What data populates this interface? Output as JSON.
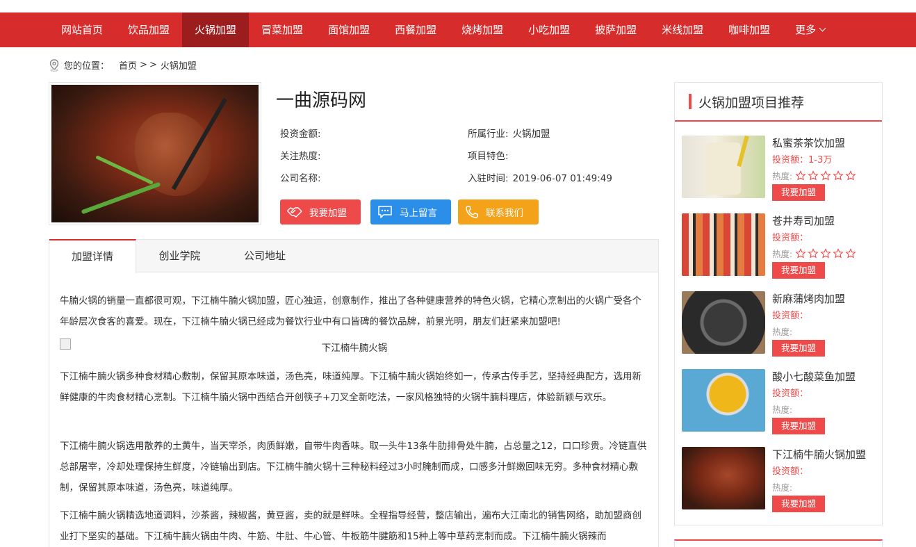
{
  "nav": {
    "items": [
      {
        "label": "网站首页"
      },
      {
        "label": "饮品加盟"
      },
      {
        "label": "火锅加盟",
        "active": true
      },
      {
        "label": "冒菜加盟"
      },
      {
        "label": "面馆加盟"
      },
      {
        "label": "西餐加盟"
      },
      {
        "label": "烧烤加盟"
      },
      {
        "label": "小吃加盟"
      },
      {
        "label": "披萨加盟"
      },
      {
        "label": "米线加盟"
      },
      {
        "label": "咖啡加盟"
      },
      {
        "label": "更多"
      }
    ]
  },
  "breadcrumb": {
    "prefix": "您的位置：",
    "home": "首页",
    "sep": ">",
    "sep2": ">",
    "current": "火锅加盟"
  },
  "project": {
    "title": "一曲源码网",
    "invest_label": "投资金额:",
    "industry_label": "所属行业:",
    "industry_value": "火锅加盟",
    "heat_label": "关注热度:",
    "feature_label": "项目特色:",
    "company_label": "公司名称:",
    "joined_label": "入驻时间:",
    "joined_value": "2019-06-07 01:49:49"
  },
  "buttons": {
    "join": "我要加盟",
    "message": "马上留言",
    "contact": "联系我们"
  },
  "tabs": [
    "加盟详情",
    "创业学院",
    "公司地址"
  ],
  "article": {
    "p1": "牛腩火锅的销量一直都很可观，下江楠牛腩火锅加盟，匠心独运，创意制作，推出了各种健康营养的特色火锅，它精心烹制出的火锅广受各个年龄层次食客的喜爱。现在，下江楠牛腩火锅已经成为餐饮行业中有口皆碑的餐饮品牌，前景光明，朋友们赶紧来加盟吧!",
    "image_caption": "下江楠牛腩火锅",
    "p2": "下江楠牛腩火锅多种食材精心敷制，保留其原本味道，汤色亮，味道纯厚。下江楠牛腩火锅始终如一，传承古传手艺，坚持经典配方，选用新鲜健康的牛肉食材精心烹制。下江楠牛腩火锅中西结合开创筷子+刀叉全新吃法，一家风格独特的火锅牛腩料理店，体验新颖与欢乐。",
    "p3": "下江楠牛腩火锅选用散养的土黄牛，当天宰杀，肉质鲜嫩，自带牛肉香味。取一头牛13条牛肋排骨处牛腩，占总量之12，口口珍贵。冷链直供总部屠宰，冷却处理保持生鲜度，冷链输出到店。下江楠牛腩火锅十三种秘料经过3小时腌制而成，口感多汁鲜嫩回味无穷。多种食材精心敷制，保留其原本味道，汤色亮，味道纯厚。",
    "p4": "下江楠牛腩火锅精选地道调料，沙茶酱，辣椒酱，黄豆酱，卖的就是鲜味。全程指导经营，整店输出，遍布大江南北的销售网络，助加盟商创业打下坚实的基础。下江楠牛腩火锅由牛肉、牛筋、牛肚、牛心管、牛板筋牛腱筋和15种上等中草药烹制而成。下江楠牛腩火锅辣而"
  },
  "sidebar": {
    "title": "火锅加盟项目推荐",
    "heat_label": "热度:",
    "join_label": "我要加盟",
    "items": [
      {
        "name": "私蜜茶茶饮加盟",
        "invest": "投资额：1-3万",
        "stars": 0
      },
      {
        "name": "苍井寿司加盟",
        "invest": "投资额：",
        "stars": 0
      },
      {
        "name": "新麻蒲烤肉加盟",
        "invest": "投资额：",
        "stars": null
      },
      {
        "name": "酸小七酸菜鱼加盟",
        "invest": "投资额：",
        "stars": null
      },
      {
        "name": "下江楠牛腩火锅加盟",
        "invest": "投资额：",
        "stars": null
      }
    ]
  },
  "colors": {
    "nav_bg": "#d72c2c",
    "nav_active": "#9c1d1d",
    "accent": "#ef4a4a",
    "message_btn": "#2b8ee8",
    "contact_btn": "#f4a21a"
  }
}
